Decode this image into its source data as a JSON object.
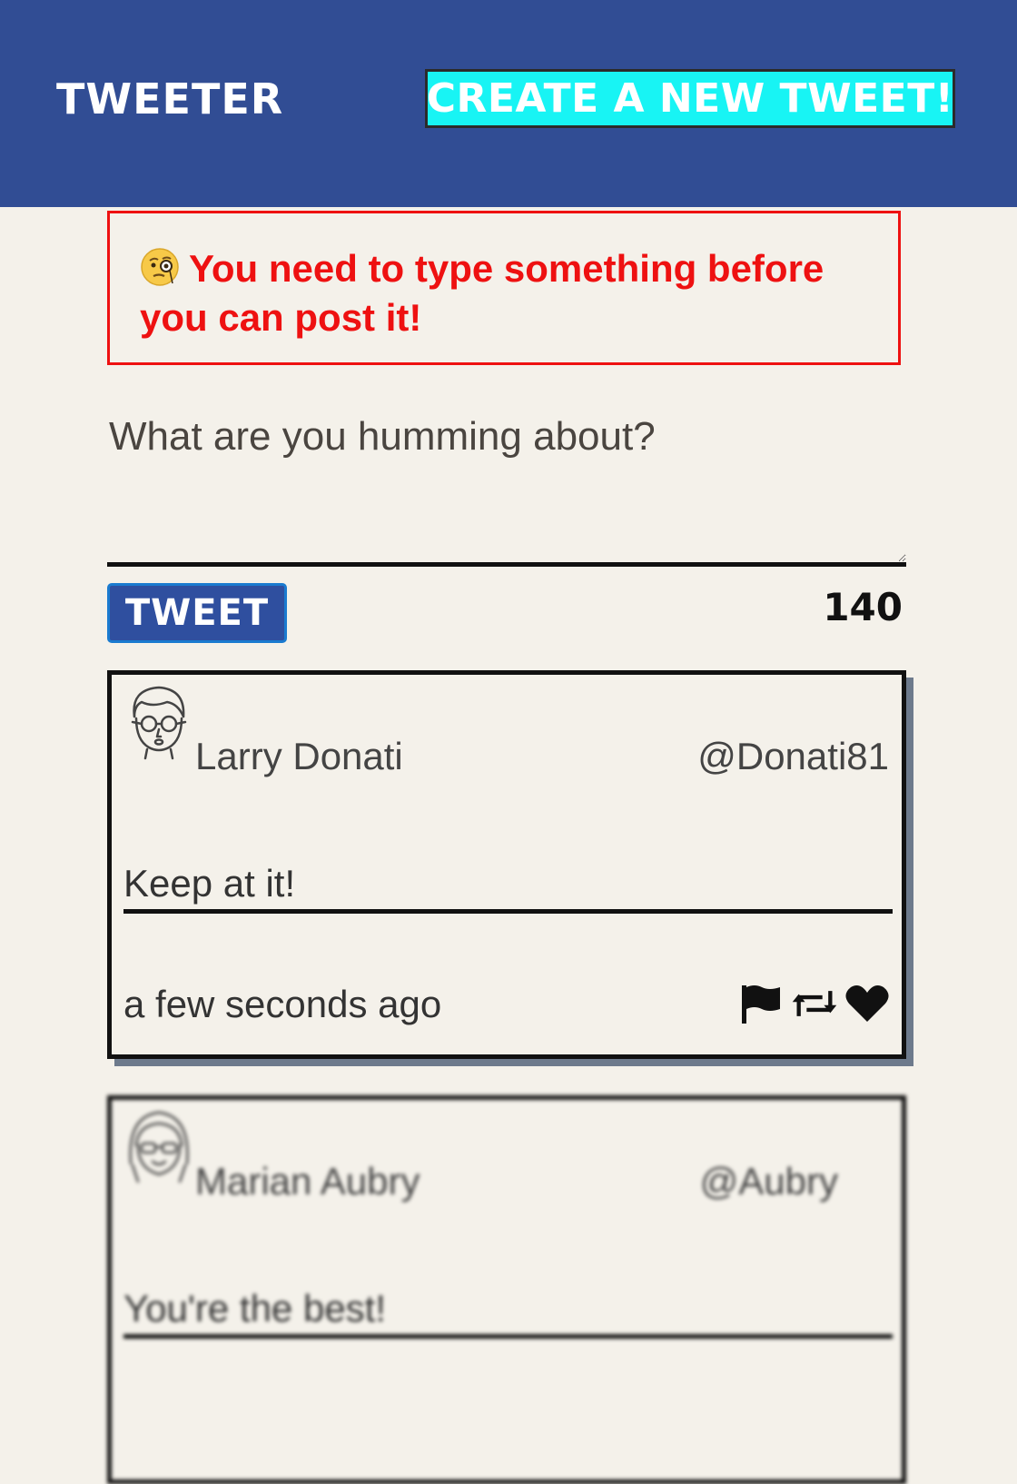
{
  "header": {
    "brand": "TWEETER",
    "compose_toggle_label": "CREATE A NEW TWEET!"
  },
  "compose": {
    "error_message": "You need to type something before you can post it!",
    "error_icon": "monocle-face-emoji",
    "placeholder": "What are you humming about?",
    "value": "",
    "submit_label": "TWEET",
    "chars_remaining": "140"
  },
  "tweets": [
    {
      "name": "Larry Donati",
      "handle": "@Donati81",
      "content": "Keep at it!",
      "timestamp": "a few seconds ago",
      "avatar_icon": "man-with-glasses-avatar-icon"
    },
    {
      "name": "Marian Aubry",
      "handle": "@Aubry",
      "content": "You're the best!",
      "avatar_icon": "woman-with-glasses-avatar-icon"
    }
  ],
  "colors": {
    "header_bg": "#314d94",
    "page_bg": "#f4f1ea",
    "accent_cyan": "#18f4f4",
    "error_red": "#ee1111",
    "button_blue": "#2f4f9f"
  }
}
